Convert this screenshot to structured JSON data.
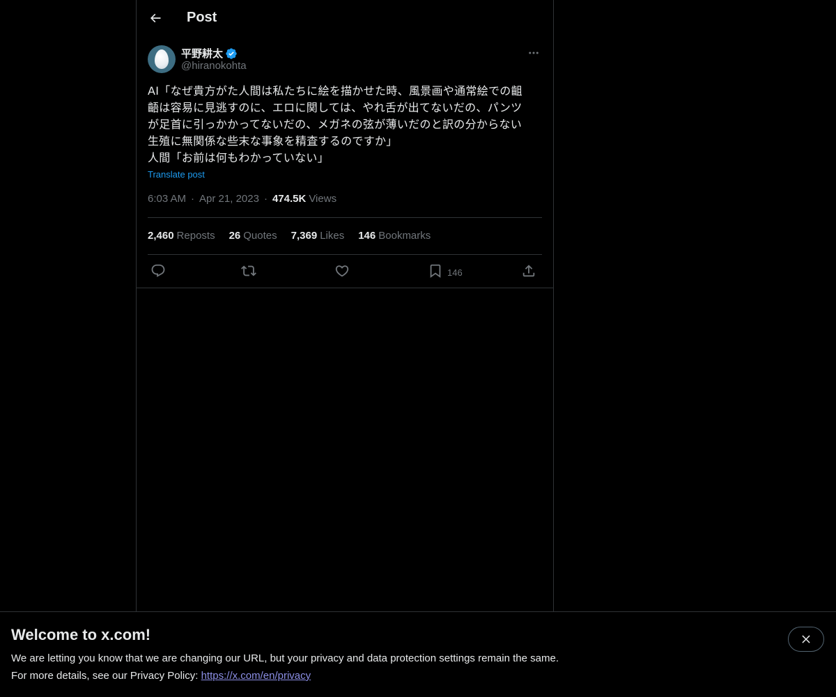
{
  "header": {
    "title": "Post",
    "back_icon": "arrow-left-icon"
  },
  "post": {
    "author": {
      "display_name": "平野耕太",
      "handle": "@hiranokohta",
      "verified": true,
      "verified_color": "#1d9bf0"
    },
    "text": "AI「なぜ貴方がた人間は私たちに絵を描かせた時、風景画や通常絵での齟\n齬は容易に見逃すのに、エロに関しては、やれ舌が出てないだの、パンツ\nが足首に引っかかってないだの、メガネの弦が薄いだのと訳の分からない\n生殖に無関係な些末な事象を精査するのですか」\n人間「お前は何もわかっていない」",
    "translate_label": "Translate post",
    "time": "6:03 AM",
    "date": "Apr 21, 2023",
    "separator": "·",
    "views_count": "474.5K",
    "views_label": "Views",
    "stats": [
      {
        "count": "2,460",
        "label": "Reposts"
      },
      {
        "count": "26",
        "label": "Quotes"
      },
      {
        "count": "7,369",
        "label": "Likes"
      },
      {
        "count": "146",
        "label": "Bookmarks"
      }
    ],
    "actions": {
      "reply_icon": "reply-icon",
      "repost_icon": "repost-icon",
      "like_icon": "heart-icon",
      "bookmark_icon": "bookmark-icon",
      "bookmark_count": "146",
      "share_icon": "share-icon"
    }
  },
  "banner": {
    "title": "Welcome to x.com!",
    "line1": "We are letting you know that we are changing our URL, but your privacy and data protection settings remain the same.",
    "line2_prefix": "For more details, see our Privacy Policy: ",
    "link_text": "https://x.com/en/privacy",
    "close_icon": "close-icon"
  },
  "colors": {
    "background": "#000000",
    "text": "#e7e9ea",
    "secondary_text": "#71767b",
    "accent": "#1d9bf0",
    "border": "#2f3336",
    "link": "#8c8fe6"
  }
}
